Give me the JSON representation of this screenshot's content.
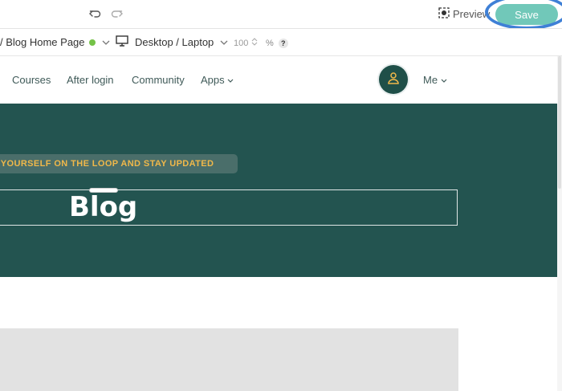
{
  "toolbar": {
    "preview_label": "Preview",
    "save_label": "Save",
    "accent_color": "#71c8b9",
    "highlight_color": "#3f80d6"
  },
  "page_bar": {
    "page_name": "/ Blog Home Page",
    "page_status_color": "#74c247",
    "device_label": "Desktop / Laptop",
    "zoom_value": "100",
    "zoom_unit": "%",
    "help_label": "?"
  },
  "nav": {
    "items": [
      {
        "label": "Courses"
      },
      {
        "label": "After login"
      },
      {
        "label": "Community"
      },
      {
        "label": "Apps"
      }
    ],
    "me_label": "Me"
  },
  "hero": {
    "tagline": "P YOURSELF ON THE LOOP AND STAY UPDATED",
    "title": "Blog",
    "background": "#235450"
  }
}
